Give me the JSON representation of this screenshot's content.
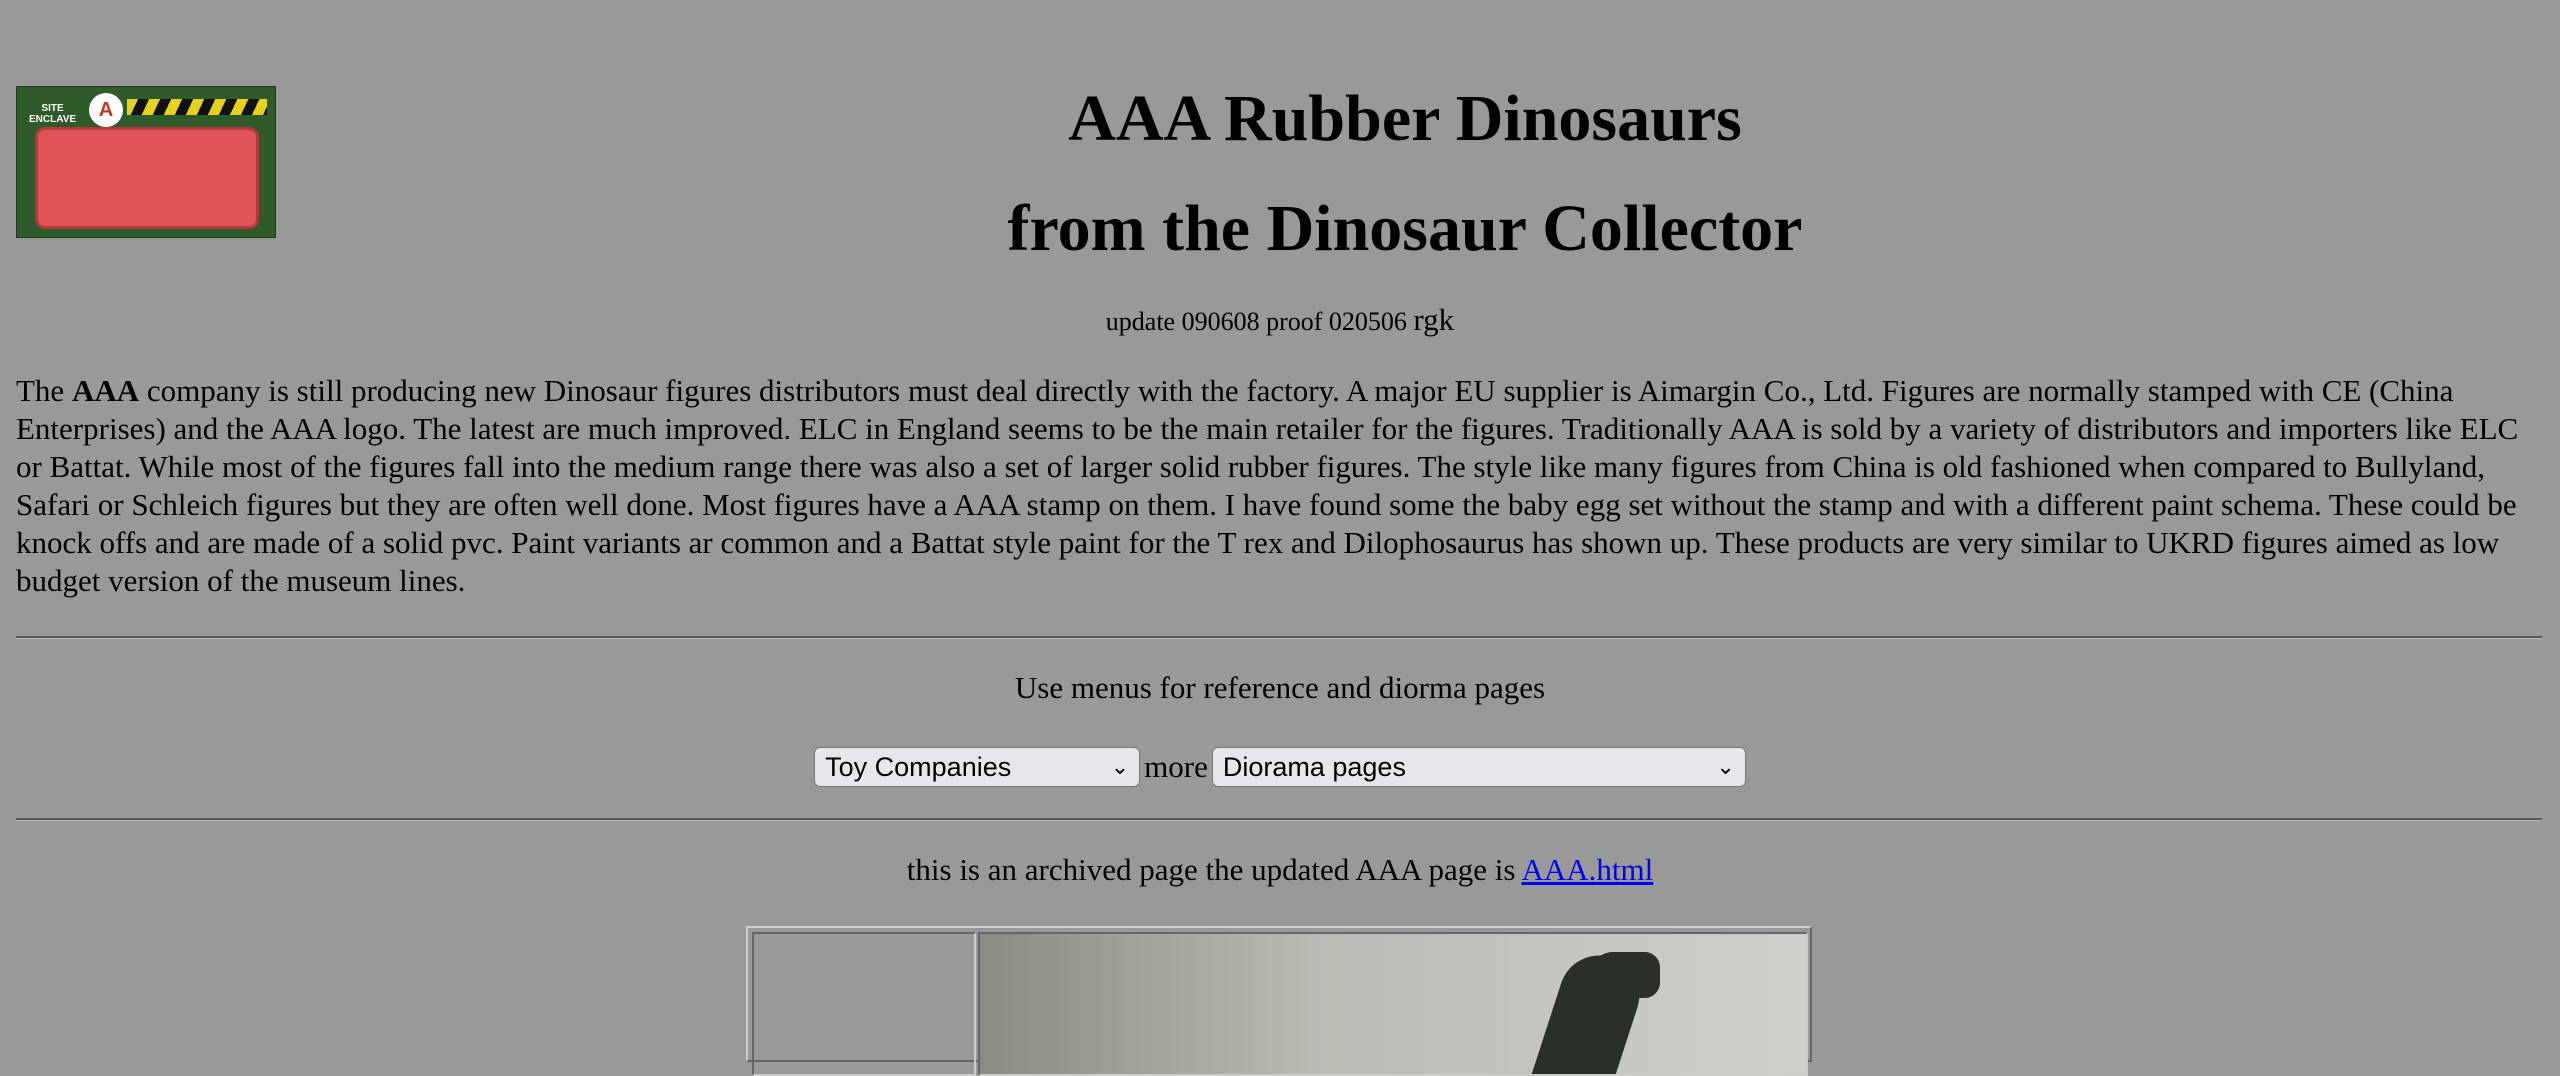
{
  "logo": {
    "badge_letter": "A",
    "enclave_line1": "SITE",
    "enclave_line2": "ENCLAVE"
  },
  "title": {
    "line1": "AAA Rubber Dinosaurs",
    "line2": "from the Dinosaur Collector"
  },
  "update": {
    "text": "update 090608 proof 020506",
    "author": "rgk"
  },
  "intro": {
    "prefix": "The ",
    "bold": "AAA",
    "rest": " company is still producing new Dinosaur figures distributors must deal directly with the factory. A major EU supplier is Aimargin Co., Ltd. Figures are normally stamped with CE (China Enterprises) and the AAA logo. The latest are much improved.  ELC in England seems to be the main retailer for the figures.  Traditionally AAA is sold by a variety of distributors and importers like ELC or Battat.  While most of the figures fall into the medium range there was also a set of larger solid rubber figures.  The style like many figures from China is old fashioned when compared to Bullyland, Safari or Schleich figures but they are often well done.  Most figures have a AAA stamp on them. I have found some the baby egg set without the stamp and with a different paint schema.  These could be knock offs and are made of a solid pvc. Paint variants ar common and a Battat style paint for the T rex and Dilophosaurus has shown up. These products are very similar to UKRD figures aimed as low budget version of the museum lines."
  },
  "menus": {
    "hint": "Use menus for reference and diorma pages",
    "select1": "Toy Companies",
    "more": "more",
    "select2": "Diorama pages"
  },
  "archived": {
    "text": "this is an archived page the updated AAA page is ",
    "link": "AAA.html"
  }
}
